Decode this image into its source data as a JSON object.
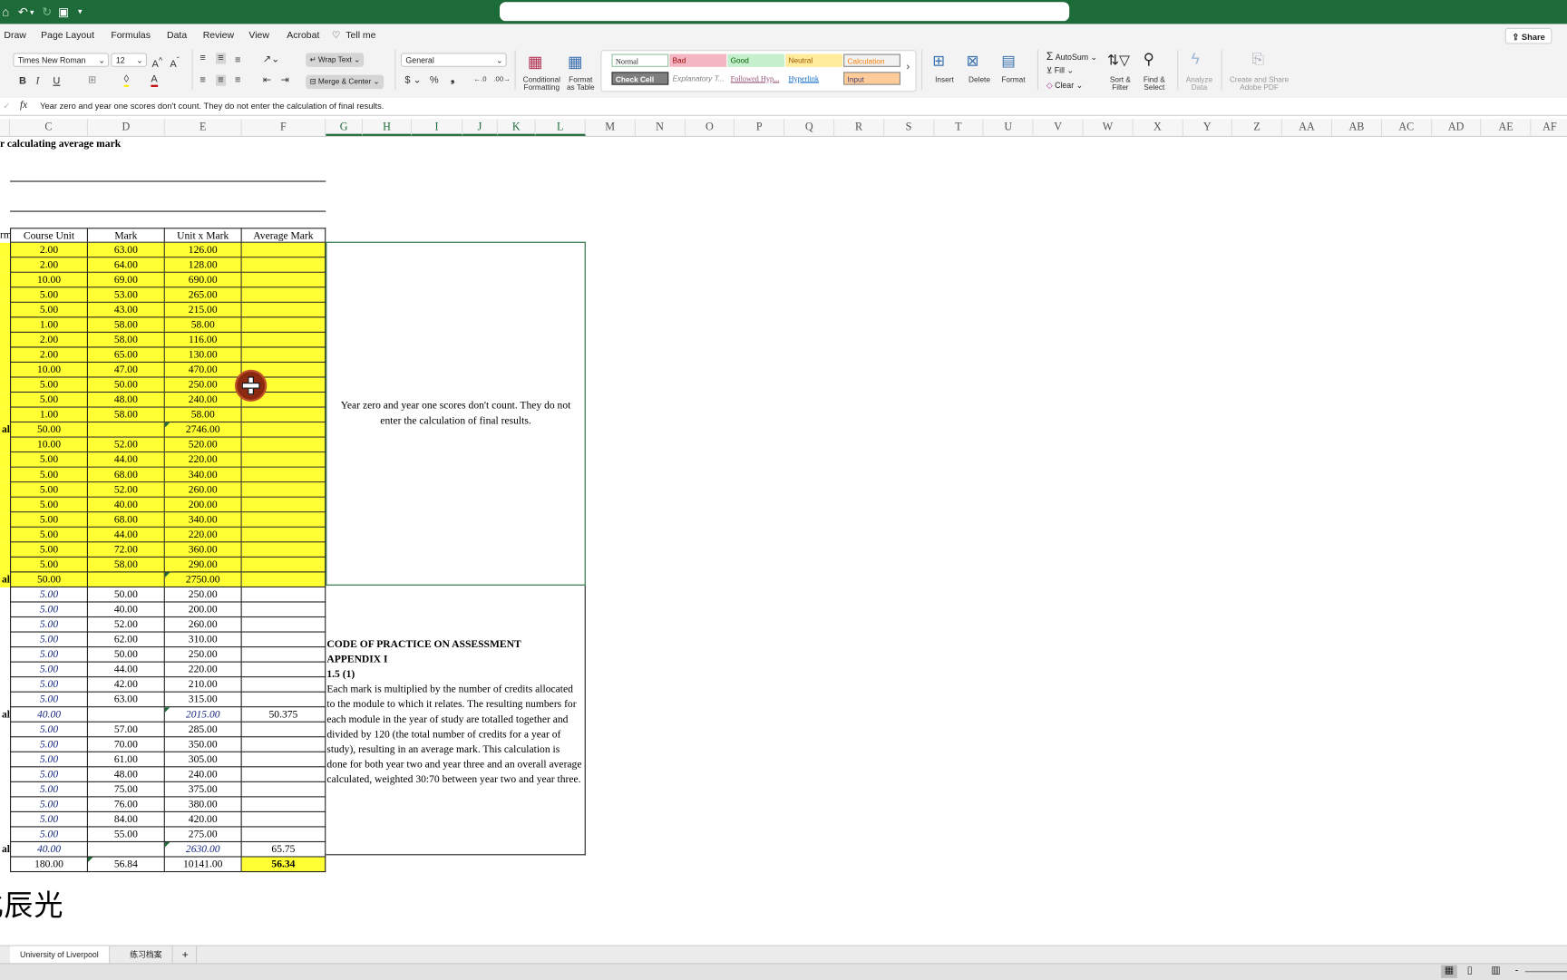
{
  "titlebar": {
    "icons": [
      "home-icon",
      "undo-icon",
      "redo-icon",
      "save-icon",
      "customize-icon"
    ]
  },
  "menu": {
    "items": [
      "Draw",
      "Page Layout",
      "Formulas",
      "Data",
      "Review",
      "View",
      "Acrobat"
    ],
    "tell_me": "Tell me",
    "share": "Share"
  },
  "ribbon": {
    "font_name": "Times New Roman",
    "font_size": "12",
    "bold": "B",
    "italic": "I",
    "underline": "U",
    "wrap_text": "Wrap Text",
    "merge_center": "Merge & Center",
    "number_format": "General",
    "currency": "$",
    "percent": "%",
    "comma": "❟",
    "conditional_formatting": "Conditional Formatting",
    "format_as_table": "Format as Table",
    "styles": [
      {
        "label": "Normal",
        "bg": "#ffffff",
        "color": "#222222"
      },
      {
        "label": "Bad",
        "bg": "#f4b6c2",
        "color": "#9c0006"
      },
      {
        "label": "Good",
        "bg": "#c6efce",
        "color": "#006100"
      },
      {
        "label": "Neutral",
        "bg": "#ffeb9c",
        "color": "#9c5700"
      },
      {
        "label": "Calculation",
        "bg": "#f2f2f2",
        "color": "#fa7d00"
      },
      {
        "label": "Check Cell",
        "bg": "#7f7f7f",
        "color": "#ffffff"
      },
      {
        "label": "Explanatory T...",
        "bg": "#ffffff",
        "color": "#7f7f7f"
      },
      {
        "label": "Followed Hyp...",
        "bg": "#ffffff",
        "color": "#954f72"
      },
      {
        "label": "Hyperlink",
        "bg": "#ffffff",
        "color": "#0563c1"
      },
      {
        "label": "Input",
        "bg": "#ffcc99",
        "color": "#3f3f76"
      }
    ],
    "insert": "Insert",
    "delete": "Delete",
    "format": "Format",
    "autosum": "AutoSum",
    "fill": "Fill",
    "clear": "Clear",
    "sort_filter": "Sort & Filter",
    "find_select": "Find & Select",
    "analyze_data": "Analyze Data",
    "adobe_pdf": "Create and Share Adobe PDF"
  },
  "formula_bar": {
    "fx": "fx",
    "content": "Year zero and year one scores don't count. They do not enter the calculation of final results."
  },
  "columns": [
    "C",
    "D",
    "E",
    "F",
    "G",
    "H",
    "I",
    "J",
    "K",
    "L",
    "M",
    "N",
    "O",
    "P",
    "Q",
    "R",
    "S",
    "T",
    "U",
    "V",
    "W",
    "X",
    "Y",
    "Z",
    "AA",
    "AB",
    "AC",
    "AD",
    "AE",
    "AF"
  ],
  "sheet": {
    "title": "r calculating average mark",
    "header_left": "rm",
    "headers": [
      "Course Unit",
      "Mark",
      "Unit x Mark",
      "Average Mark"
    ],
    "rows": [
      {
        "s": "y",
        "c": [
          "2.00",
          "63.00",
          "126.00",
          ""
        ]
      },
      {
        "s": "y",
        "c": [
          "2.00",
          "64.00",
          "128.00",
          ""
        ]
      },
      {
        "s": "y",
        "c": [
          "10.00",
          "69.00",
          "690.00",
          ""
        ]
      },
      {
        "s": "y",
        "c": [
          "5.00",
          "53.00",
          "265.00",
          ""
        ]
      },
      {
        "s": "y",
        "c": [
          "5.00",
          "43.00",
          "215.00",
          ""
        ]
      },
      {
        "s": "y",
        "c": [
          "1.00",
          "58.00",
          "58.00",
          ""
        ]
      },
      {
        "s": "y",
        "c": [
          "2.00",
          "58.00",
          "116.00",
          ""
        ]
      },
      {
        "s": "y",
        "c": [
          "2.00",
          "65.00",
          "130.00",
          ""
        ]
      },
      {
        "s": "y",
        "c": [
          "10.00",
          "47.00",
          "470.00",
          ""
        ]
      },
      {
        "s": "y",
        "c": [
          "5.00",
          "50.00",
          "250.00",
          ""
        ]
      },
      {
        "s": "y",
        "c": [
          "5.00",
          "48.00",
          "240.00",
          ""
        ]
      },
      {
        "s": "y",
        "c": [
          "1.00",
          "58.00",
          "58.00",
          ""
        ]
      },
      {
        "s": "yt",
        "label": "al",
        "c": [
          "50.00",
          "",
          "2746.00",
          ""
        ]
      },
      {
        "s": "y",
        "c": [
          "10.00",
          "52.00",
          "520.00",
          ""
        ]
      },
      {
        "s": "y",
        "c": [
          "5.00",
          "44.00",
          "220.00",
          ""
        ]
      },
      {
        "s": "y",
        "c": [
          "5.00",
          "68.00",
          "340.00",
          ""
        ]
      },
      {
        "s": "y",
        "c": [
          "5.00",
          "52.00",
          "260.00",
          ""
        ]
      },
      {
        "s": "y",
        "c": [
          "5.00",
          "40.00",
          "200.00",
          ""
        ]
      },
      {
        "s": "y",
        "c": [
          "5.00",
          "68.00",
          "340.00",
          ""
        ]
      },
      {
        "s": "y",
        "c": [
          "5.00",
          "44.00",
          "220.00",
          ""
        ]
      },
      {
        "s": "y",
        "c": [
          "5.00",
          "72.00",
          "360.00",
          ""
        ]
      },
      {
        "s": "y",
        "c": [
          "5.00",
          "58.00",
          "290.00",
          ""
        ]
      },
      {
        "s": "yt",
        "label": "al",
        "c": [
          "50.00",
          "",
          "2750.00",
          ""
        ]
      },
      {
        "s": "w",
        "c": [
          "5.00",
          "50.00",
          "250.00",
          ""
        ]
      },
      {
        "s": "w",
        "c": [
          "5.00",
          "40.00",
          "200.00",
          ""
        ]
      },
      {
        "s": "w",
        "c": [
          "5.00",
          "52.00",
          "260.00",
          ""
        ]
      },
      {
        "s": "w",
        "c": [
          "5.00",
          "62.00",
          "310.00",
          ""
        ]
      },
      {
        "s": "w",
        "c": [
          "5.00",
          "50.00",
          "250.00",
          ""
        ]
      },
      {
        "s": "w",
        "c": [
          "5.00",
          "44.00",
          "220.00",
          ""
        ]
      },
      {
        "s": "w",
        "c": [
          "5.00",
          "42.00",
          "210.00",
          ""
        ]
      },
      {
        "s": "w",
        "c": [
          "5.00",
          "63.00",
          "315.00",
          ""
        ]
      },
      {
        "s": "wt",
        "label": "al",
        "c": [
          "40.00",
          "",
          "2015.00",
          "50.375"
        ]
      },
      {
        "s": "w",
        "c": [
          "5.00",
          "57.00",
          "285.00",
          ""
        ]
      },
      {
        "s": "w",
        "c": [
          "5.00",
          "70.00",
          "350.00",
          ""
        ]
      },
      {
        "s": "w",
        "c": [
          "5.00",
          "61.00",
          "305.00",
          ""
        ]
      },
      {
        "s": "w",
        "c": [
          "5.00",
          "48.00",
          "240.00",
          ""
        ]
      },
      {
        "s": "w",
        "c": [
          "5.00",
          "75.00",
          "375.00",
          ""
        ]
      },
      {
        "s": "w",
        "c": [
          "5.00",
          "76.00",
          "380.00",
          ""
        ]
      },
      {
        "s": "w",
        "c": [
          "5.00",
          "84.00",
          "420.00",
          ""
        ]
      },
      {
        "s": "w",
        "c": [
          "5.00",
          "55.00",
          "275.00",
          ""
        ]
      },
      {
        "s": "wt",
        "label": "al",
        "c": [
          "40.00",
          "",
          "2630.00",
          "65.75"
        ]
      },
      {
        "s": "f",
        "c": [
          "180.00",
          "56.84",
          "10141.00",
          "56.34"
        ]
      }
    ],
    "note_year_zero": "Year zero and year one scores don't count. They do not enter the calculation of final results.",
    "code_heading": [
      "CODE OF PRACTICE ON ASSESSMENT",
      "APPENDIX I",
      "1.5 (1)"
    ],
    "code_body": "Each mark is multiplied by the number of credits allocated to the module to which it relates. The resulting numbers for each module in the year of study are totalled together and divided by 120 (the total number of credits for a year of study), resulting in an average mark. This calculation is done for both year two and year three and an overall average calculated, weighted 30:70 between year two and year three.",
    "watermark_text": "北辰光"
  },
  "sheet_tabs": [
    "University of Liverpool",
    "练习档案"
  ],
  "add_sheet": "+",
  "colors": {
    "accent": "#1e6b3a",
    "highlight": "#ffff33",
    "italic_blue": "#1a2a80"
  }
}
